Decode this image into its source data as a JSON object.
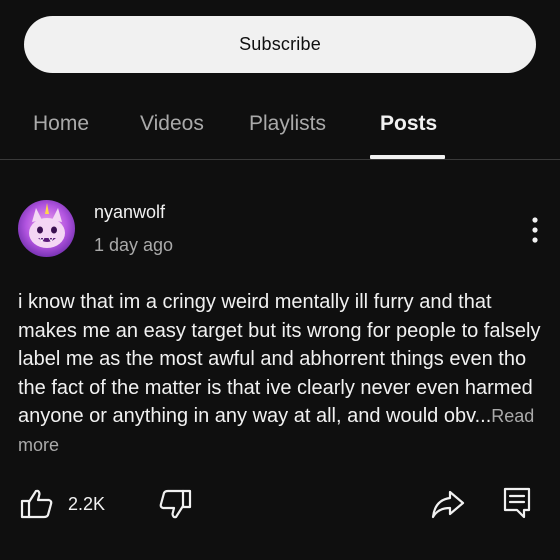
{
  "subscribe_label": "Subscribe",
  "tabs": [
    {
      "label": "Home",
      "active": false
    },
    {
      "label": "Videos",
      "active": false
    },
    {
      "label": "Playlists",
      "active": false
    },
    {
      "label": "Posts",
      "active": true
    }
  ],
  "post": {
    "author": "nyanwolf",
    "time": "1 day ago",
    "text": "i know that im a cringy weird mentally ill furry and that makes me an easy target but its wrong for people to falsely label me as the most awful and abhorrent things even tho the fact of the matter is that ive clearly never even harmed anyone or anything in any way at all, and would obv...",
    "read_more": "Read more",
    "like_count": "2.2K"
  },
  "icons": {
    "avatar": "avatar-icon",
    "menu": "more-vertical-icon",
    "like": "thumbs-up-icon",
    "dislike": "thumbs-down-icon",
    "share": "share-icon",
    "comment": "comment-icon"
  },
  "colors": {
    "background": "#0f0f0f",
    "text": "#f1f1f1",
    "muted": "#aaaaaa",
    "subscribe_bg": "#f1f1f1",
    "avatar_purple": "#8e3fd6",
    "avatar_pink": "#e86bd6"
  }
}
